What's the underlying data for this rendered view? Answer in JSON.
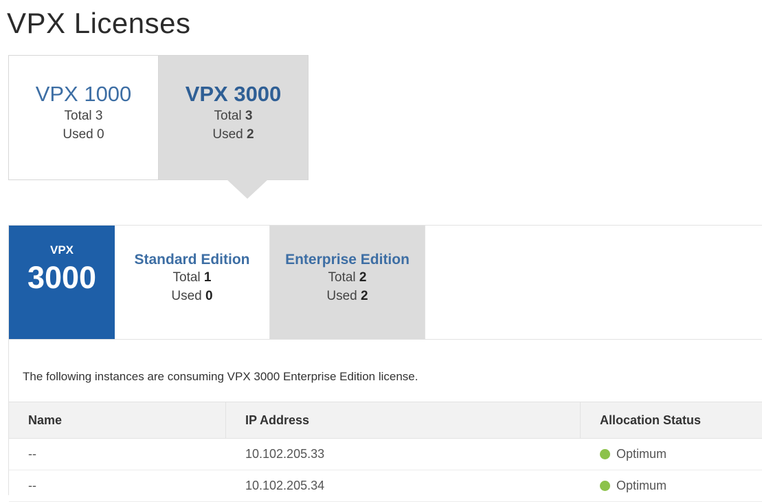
{
  "page": {
    "title": "VPX Licenses"
  },
  "models": [
    {
      "title": "VPX 1000",
      "total_label": "Total",
      "total": "3",
      "used_label": "Used",
      "used": "0",
      "active": false
    },
    {
      "title": "VPX 3000",
      "total_label": "Total",
      "total": "3",
      "used_label": "Used",
      "used": "2",
      "active": true
    }
  ],
  "selected_model": {
    "prefix": "VPX",
    "number": "3000",
    "color": "#1e5fa8"
  },
  "editions": [
    {
      "title": "Standard Edition",
      "total_label": "Total",
      "total": "1",
      "used_label": "Used",
      "used": "0",
      "active": false
    },
    {
      "title": "Enterprise Edition",
      "total_label": "Total",
      "total": "2",
      "used_label": "Used",
      "used": "2",
      "active": true
    }
  ],
  "description": "The following instances are consuming VPX 3000 Enterprise Edition license.",
  "table": {
    "columns": [
      "Name",
      "IP Address",
      "Allocation Status"
    ],
    "rows": [
      {
        "name": "--",
        "ip": "10.102.205.33",
        "status": "Optimum",
        "status_color": "#8cc24b"
      },
      {
        "name": "--",
        "ip": "10.102.205.34",
        "status": "Optimum",
        "status_color": "#8cc24b"
      }
    ]
  }
}
